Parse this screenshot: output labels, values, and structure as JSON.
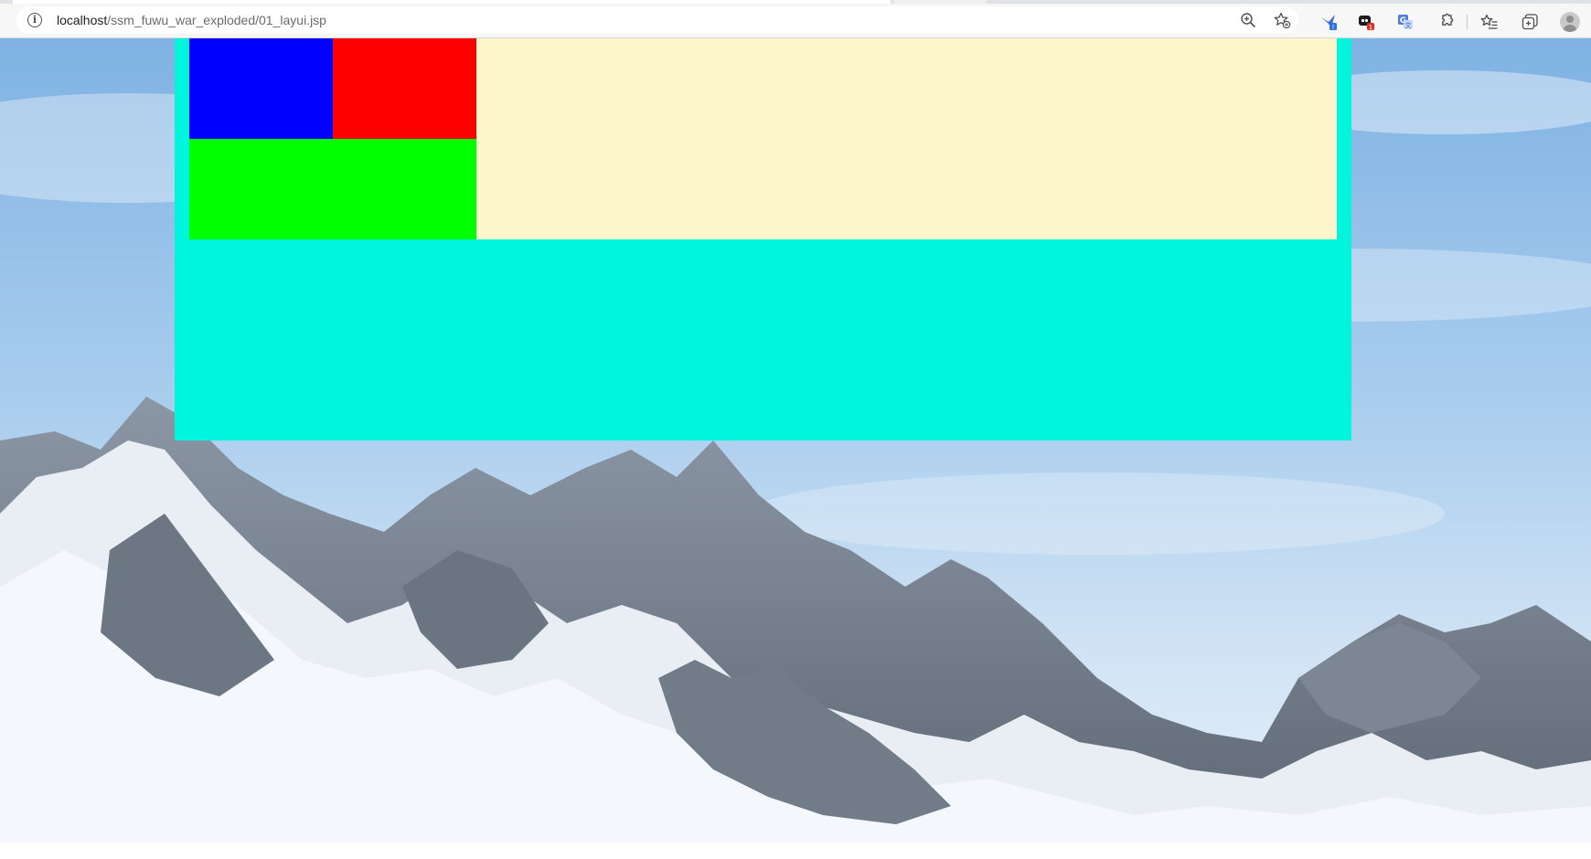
{
  "browser": {
    "address_bar": {
      "url_host": "localhost",
      "url_path": "/ssm_fuwu_war_exploded/01_layui.jsp"
    },
    "icons": [
      "site-info-icon",
      "zoom-icon",
      "add-favorite-icon",
      "extension-badge-icon",
      "extension-counter-icon",
      "translate-icon",
      "extensions-icon",
      "favorites-icon",
      "collections-icon",
      "profile-avatar"
    ]
  },
  "page": {
    "layout_colors": {
      "container": "#00f5dc",
      "header_panel": "#fdf7cb",
      "blue_block": "#0000ff",
      "red_block": "#ff0000",
      "green_block": "#00ff00"
    },
    "background": "snowy mountain wallpaper"
  }
}
